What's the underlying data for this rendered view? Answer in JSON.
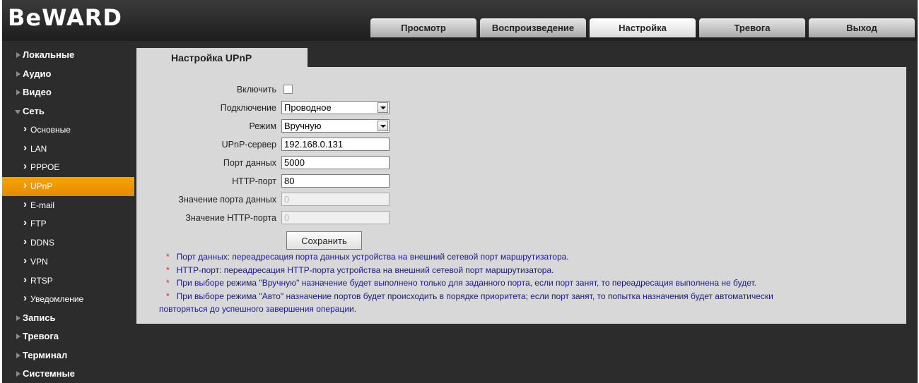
{
  "brand": "BeWARD",
  "tabs": [
    {
      "label": "Просмотр",
      "active": false
    },
    {
      "label": "Воспроизведение",
      "active": false
    },
    {
      "label": "Настройка",
      "active": true
    },
    {
      "label": "Тревога",
      "active": false
    },
    {
      "label": "Выход",
      "active": false
    }
  ],
  "sidebar": {
    "local": "Локальные",
    "audio": "Аудио",
    "video": "Видео",
    "network": "Сеть",
    "network_items": [
      "Основные",
      "LAN",
      "PPPOE",
      "UPnP",
      "E-mail",
      "FTP",
      "DDNS",
      "VPN",
      "RTSP",
      "Уведомление"
    ],
    "active_item": "UPnP",
    "record": "Запись",
    "alarm": "Тревога",
    "terminal": "Терминал",
    "system": "Системные"
  },
  "panel": {
    "title": "Настройка UPnP",
    "enable_label": "Включить",
    "enable_checked": false,
    "connection_label": "Подключение",
    "connection_value": "Проводное",
    "mode_label": "Режим",
    "mode_value": "Вручную",
    "server_label": "UPnP-сервер",
    "server_value": "192.168.0.131",
    "data_port_label": "Порт данных",
    "data_port_value": "5000",
    "http_port_label": "HTTP-порт",
    "http_port_value": "80",
    "data_port_mapped_label": "Значение порта данных",
    "data_port_mapped_value": "0",
    "http_port_mapped_label": "Значение HTTP-порта",
    "http_port_mapped_value": "0",
    "save_label": "Сохранить"
  },
  "notes": {
    "marker": "*",
    "n1": "Порт данных: переадресация порта данных устройства на внешний сетевой порт маршрутизатора.",
    "n2": "HTTP-порт: переадресация HTTP-порта устройства на внешний сетевой порт маршрутизатора.",
    "n3": "При выборе режима \"Вручную\" назначение будет выполнено только для заданного порта, если порт занят, то переадресация выполнена не будет.",
    "n4a": "При выборе режима \"Авто\" назначение портов будет происходить в порядке приоритета; если порт занят, то попытка назначения будет автоматически",
    "n4b": "повторяться до успешного завершения операции."
  },
  "colors": {
    "accent": "#f39c00",
    "background": "#2c2c2c",
    "panel": "#d8d8d8",
    "note_text": "#1a1a8c",
    "note_marker": "#e02020"
  }
}
